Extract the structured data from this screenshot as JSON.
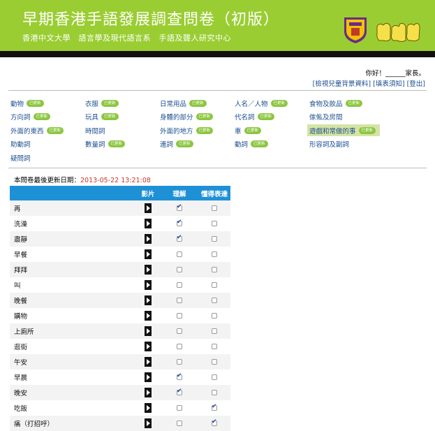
{
  "header": {
    "title": "早期香港手語發展調查問卷（初版）",
    "subtitle": "香港中文大學　語言學及現代語言系　手語及聾人研究中心"
  },
  "user": {
    "greeting": "你好！______家長。",
    "links": [
      "[檢視兒童背景資料]",
      "[填表須知]",
      "[登出]"
    ]
  },
  "badge_label": "已更新",
  "categories": [
    [
      {
        "label": "動物",
        "badge": true
      },
      {
        "label": "衣服",
        "badge": true
      },
      {
        "label": "日常用品",
        "badge": true
      },
      {
        "label": "人名／人物",
        "badge": true
      },
      {
        "label": "食物及飲品",
        "badge": true
      }
    ],
    [
      {
        "label": "方向詞",
        "badge": true
      },
      {
        "label": "玩具",
        "badge": true
      },
      {
        "label": "身體的部分",
        "badge": true
      },
      {
        "label": "代名詞",
        "badge": true
      },
      {
        "label": "傢俬及房間",
        "badge": false
      }
    ],
    [
      {
        "label": "外面的東西",
        "badge": true
      },
      {
        "label": "時間詞",
        "badge": false
      },
      {
        "label": "外面的地方",
        "badge": true
      },
      {
        "label": "車",
        "badge": true
      },
      {
        "label": "遊戲和常做的事",
        "badge": true,
        "active": true
      }
    ],
    [
      {
        "label": "助動詞",
        "badge": false
      },
      {
        "label": "數量詞",
        "badge": true
      },
      {
        "label": "連詞",
        "badge": true
      },
      {
        "label": "動詞",
        "badge": true
      },
      {
        "label": "形容詞及副詞",
        "badge": false
      }
    ],
    [
      {
        "label": "疑問詞",
        "badge": false
      }
    ]
  ],
  "last_updated": {
    "label": "本問卷最後更新日期：",
    "date": "2013-05-22 13:21:08"
  },
  "table": {
    "headers": [
      "",
      "影片",
      "理解",
      "懂得表達"
    ],
    "rows": [
      {
        "word": "再",
        "understand": true,
        "express": false
      },
      {
        "word": "洗澡",
        "understand": true,
        "express": false
      },
      {
        "word": "肅靜",
        "understand": true,
        "express": false
      },
      {
        "word": "早餐",
        "understand": false,
        "express": false
      },
      {
        "word": "拜拜",
        "understand": false,
        "express": false
      },
      {
        "word": "叫",
        "understand": false,
        "express": false
      },
      {
        "word": "晚餐",
        "understand": false,
        "express": false
      },
      {
        "word": "購物",
        "understand": false,
        "express": false
      },
      {
        "word": "上廁所",
        "understand": false,
        "express": false
      },
      {
        "word": "逛街",
        "understand": false,
        "express": false
      },
      {
        "word": "午安",
        "understand": false,
        "express": false
      },
      {
        "word": "早晨",
        "understand": true,
        "express": false
      },
      {
        "word": "晚安",
        "understand": true,
        "express": false
      },
      {
        "word": "吃飯",
        "understand": false,
        "express": true
      },
      {
        "word": "痛（打招呼）",
        "understand": false,
        "express": true
      }
    ]
  },
  "colors": {
    "header_bg": "#9acd32",
    "table_header_bg": "#1e90d6",
    "badge_bg": "#8cc640",
    "date_color": "#c0392b",
    "link_color": "#1a4d8f"
  }
}
